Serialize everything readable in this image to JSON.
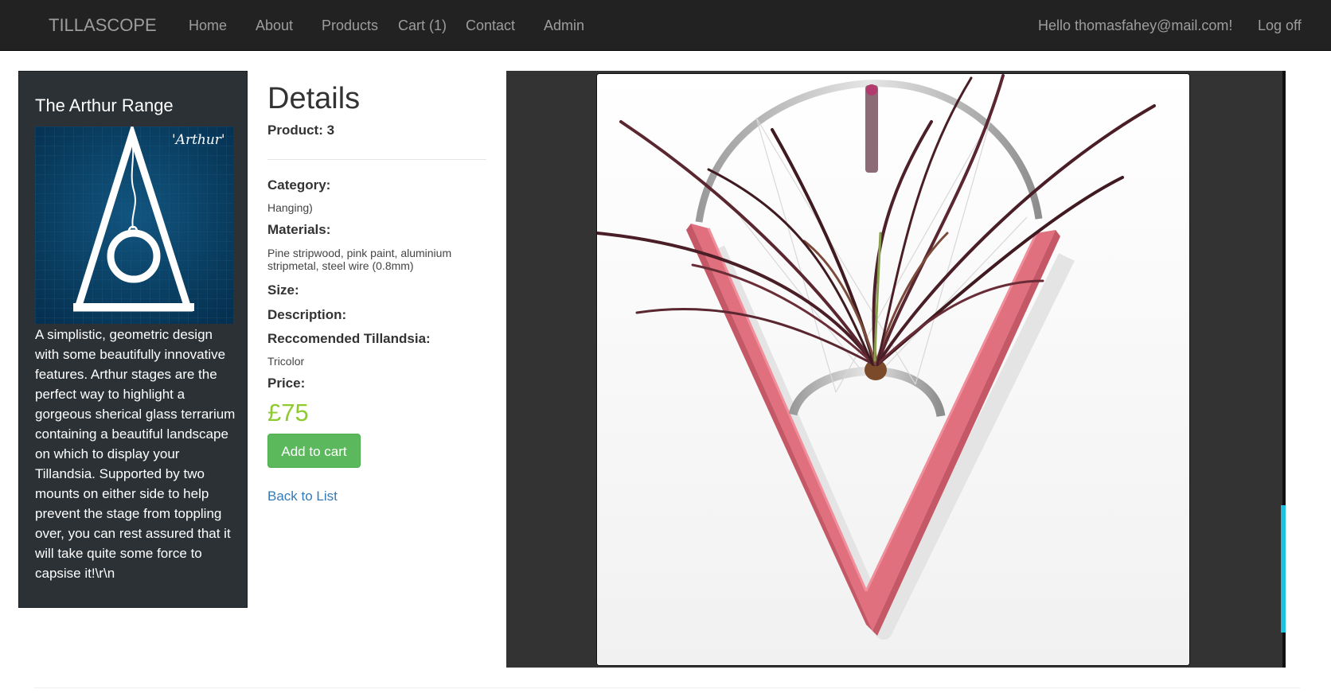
{
  "navbar": {
    "brand": "TILLASCOPE",
    "items": [
      {
        "label": "Home"
      },
      {
        "label": "About"
      },
      {
        "label": "Products"
      },
      {
        "label": "Cart (1)"
      },
      {
        "label": "Contact"
      },
      {
        "label": "Admin"
      }
    ],
    "greeting": "Hello thomasfahey@mail.com!",
    "logoff": "Log off"
  },
  "sidebar": {
    "title": "The Arthur Range",
    "thumbnail_script": "'Arthur'",
    "description": "A simplistic, geometric design with some beautifully innovative features. Arthur stages are the perfect way to highlight a gorgeous sherical glass terrarium containing a beautiful landscape on which to display your Tillandsia. Supported by two mounts on either side to help prevent the stage from toppling over, you can rest assured that it will take quite some force to capsise it!\\r\\n"
  },
  "details": {
    "title": "Details",
    "product_line": "Product: 3",
    "category_label": "Category:",
    "category_value": "Hanging)",
    "materials_label": "Materials:",
    "materials_value": "Pine stripwood, pink paint, aluminium stripmetal, steel wire (0.8mm)",
    "size_label": "Size:",
    "description_label": "Description:",
    "tillandsia_label": "Reccomended Tillandsia:",
    "tillandsia_value": "Tricolor",
    "price_label": "Price:",
    "price_value": "£75",
    "add_to_cart": "Add to cart",
    "back_to_list": "Back to List"
  },
  "colors": {
    "navbar_bg": "#222222",
    "nav_text": "#9d9d9d",
    "sidebar_bg": "#2b3135",
    "price": "#8ecb2f",
    "button": "#5cb85c",
    "link": "#337ab7",
    "viewer_bg": "#333333",
    "frame_pink": "#e06070",
    "scroll_accent": "#1fc0e0"
  }
}
